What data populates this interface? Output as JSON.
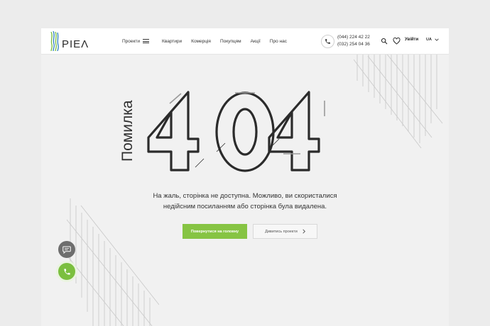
{
  "brand": {
    "name": "PIEΛ",
    "accent": "#86c443",
    "logo_colors": [
      "#7bbf3f",
      "#2f7fc2",
      "#2a2a2a"
    ]
  },
  "nav": {
    "projects_label": "Проекти",
    "items": [
      "Квартири",
      "Комерція",
      "Покупцям",
      "Акції",
      "Про нас"
    ]
  },
  "contacts": {
    "phone_1": "(044) 224 42 22",
    "phone_2": "(032) 254 04 36"
  },
  "header_actions": {
    "login_label": "Увійти",
    "language": "UA",
    "icons": [
      "search-icon",
      "heart-icon",
      "phone-icon",
      "chevron-down-icon"
    ]
  },
  "error": {
    "vertical_title": "Помилка",
    "code": "404",
    "message_line_1": "На жаль, сторінка не доступна. Можливо, ви скористалися",
    "message_line_2": "недійсним посиланням або сторінка була видалена."
  },
  "buttons": {
    "primary": "Повернутися на головну",
    "secondary": "Дивитись проекти"
  },
  "floating": {
    "icons": [
      "chat-icon",
      "phone-icon"
    ],
    "chat_color": "#6e6e6e",
    "call_color": "#7bbf3f"
  }
}
